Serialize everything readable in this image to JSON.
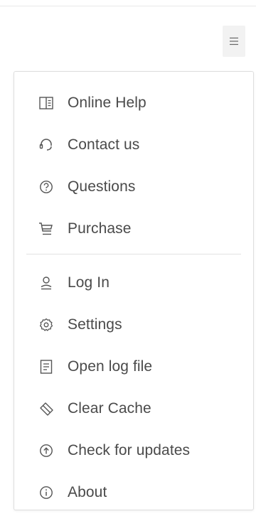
{
  "toolbar": {
    "menu_icon": "hamburger-icon"
  },
  "menu": {
    "section1": [
      {
        "label": "Online Help",
        "icon": "book-icon"
      },
      {
        "label": "Contact us",
        "icon": "headset-icon"
      },
      {
        "label": "Questions",
        "icon": "question-circle-icon"
      },
      {
        "label": "Purchase",
        "icon": "cart-icon"
      }
    ],
    "section2": [
      {
        "label": "Log In",
        "icon": "user-icon"
      },
      {
        "label": "Settings",
        "icon": "gear-icon"
      },
      {
        "label": "Open log file",
        "icon": "document-icon"
      },
      {
        "label": "Clear Cache",
        "icon": "eraser-icon"
      },
      {
        "label": "Check for updates",
        "icon": "arrow-up-circle-icon"
      },
      {
        "label": "About",
        "icon": "info-circle-icon"
      }
    ]
  },
  "colors": {
    "text": "#4a4a4a",
    "icon": "#555555",
    "border": "#dedede",
    "toggle_bg": "#f2f2f2"
  }
}
